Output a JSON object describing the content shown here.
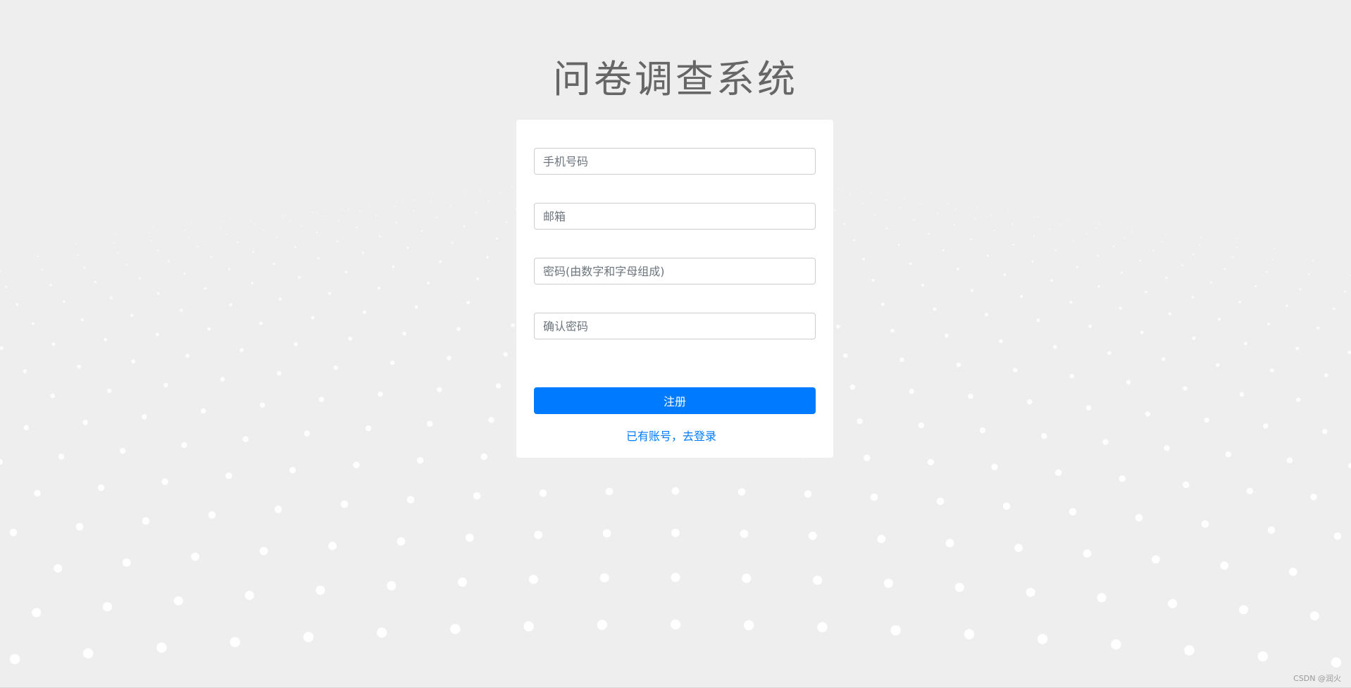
{
  "page": {
    "title": "问卷调查系统"
  },
  "form": {
    "phone_placeholder": "手机号码",
    "email_placeholder": "邮箱",
    "password_placeholder": "密码(由数字和字母组成)",
    "confirm_placeholder": "确认密码",
    "phone_value": "",
    "email_value": "",
    "password_value": "",
    "confirm_value": "",
    "submit_label": "注册",
    "login_link_label": "已有账号，去登录"
  },
  "footer": {
    "watermark": "CSDN @润火"
  },
  "colors": {
    "background": "#eeeeee",
    "card": "#ffffff",
    "accent": "#007bff",
    "title": "#666666",
    "dots": "#ffffff"
  }
}
